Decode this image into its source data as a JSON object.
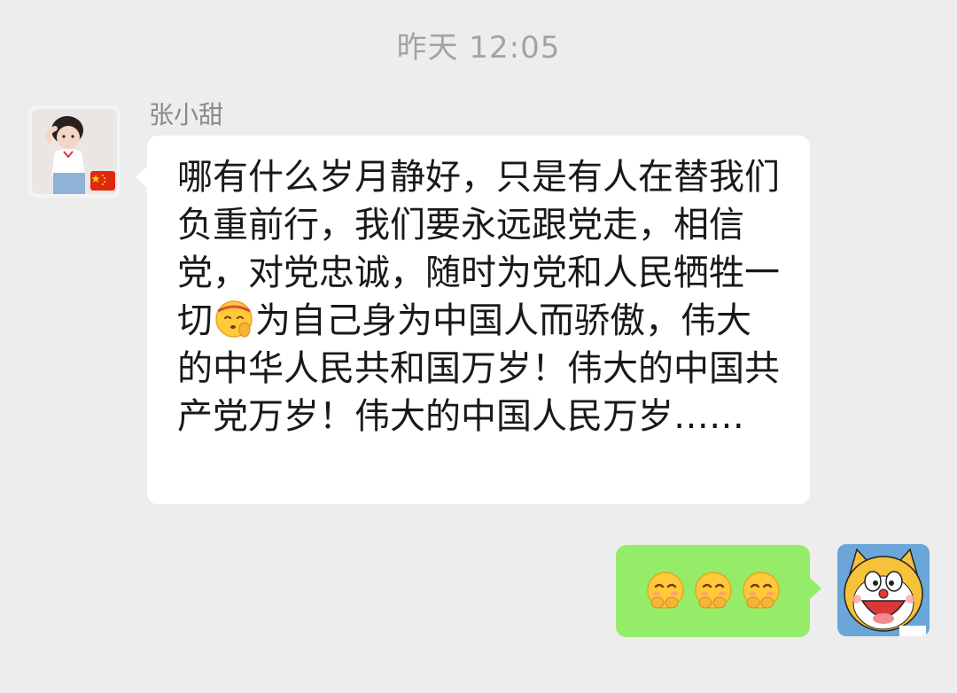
{
  "timestamp": "昨天 12:05",
  "messages": [
    {
      "sender": "张小甜",
      "direction": "incoming",
      "text_part1": "哪有什么岁月静好，只是有人在替我们负重前行，我们要永远跟党走，相信党，对党忠诚，随时为党和人民牺牲一切",
      "inline_emoji": "saluting-face-emoji",
      "text_part2": "为自己身为中国人而骄傲，伟大的中华人民共和国万岁！伟大的中国共产党万岁！伟大的中国人民万岁……"
    },
    {
      "direction": "outgoing",
      "emojis": [
        "giggle-face-emoji",
        "giggle-face-emoji",
        "giggle-face-emoji"
      ]
    }
  ],
  "colors": {
    "background": "#ededed",
    "incoming_bubble": "#ffffff",
    "outgoing_bubble": "#95ec69",
    "timestamp_text": "#a3a3a3",
    "name_text": "#8a8a8a",
    "message_text": "#191919"
  },
  "icons": {
    "left_avatar": "child-photo-avatar-with-china-flag",
    "right_avatar": "yellow-cartoon-cat-avatar"
  }
}
